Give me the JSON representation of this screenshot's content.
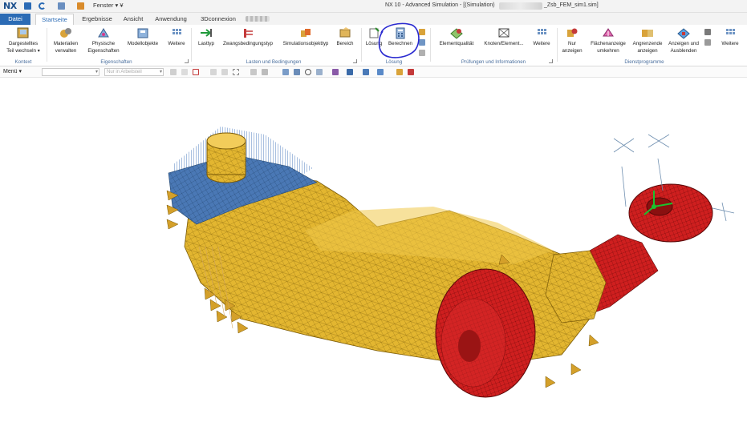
{
  "window": {
    "logo": "NX",
    "window_menu": "Fenster ▾ ¥",
    "title": "NX 10 - Advanced Simulation - [(Simulation)",
    "title_file": "_Zsb_FEM_sim1.sim]"
  },
  "tabs": [
    {
      "label": "Datei",
      "active": false
    },
    {
      "label": "Startseite",
      "active": true
    },
    {
      "label": "Ergebnisse",
      "active": false
    },
    {
      "label": "Ansicht",
      "active": false
    },
    {
      "label": "Anwendung",
      "active": false
    },
    {
      "label": "3Dconnexion",
      "active": false
    }
  ],
  "ribbon": {
    "kontext": {
      "group_label": "Kontext",
      "btn1_line1": "Dargestelltes",
      "btn1_line2": "Teil wechseln ▾"
    },
    "eigenschaften": {
      "group_label": "Eigenschaften",
      "materialien_line1": "Materialien",
      "materialien_line2": "verwalten",
      "physische_line1": "Physische",
      "physische_line2": "Eigenschaften",
      "modellobjekte": "Modellobjekte",
      "weitere": "Weitere"
    },
    "lasten": {
      "group_label": "Lasten und Bedingungen",
      "lasttyp": "Lasttyp",
      "zwangs": "Zwangsbedingungstyp",
      "simobj": "Simulationsobjekttyp",
      "bereich": "Bereich"
    },
    "loesung": {
      "group_label": "Lösung",
      "loesung": "Lösung",
      "berechnen": "Berechnen"
    },
    "pruefungen": {
      "group_label": "Prüfungen und Informationen",
      "elementqualitaet": "Elementqualität",
      "knoten": "Knoten/Element...",
      "weitere": "Weitere"
    },
    "dienst": {
      "group_label": "Dienstprogramme",
      "nur_line1": "Nur",
      "nur_line2": "anzeigen",
      "flaechen_line1": "Flächenanzeige",
      "flaechen_line2": "umkehren",
      "angrenz_line1": "Angrenzende",
      "angrenz_line2": "anzeigen",
      "anzeigen_line1": "Anzeigen und",
      "anzeigen_line2": "Ausblenden",
      "weitere": "Weitere"
    }
  },
  "command_bar": {
    "menu_label": "Menü ▾",
    "filter_placeholder": "Nur in Arbeitsteil"
  },
  "colors": {
    "accent": "#2b6bb5",
    "mesh_yellow": "#e0b52c",
    "mesh_red": "#cc1f1f",
    "mesh_blue": "#4a78b5",
    "annotation": "#2a2ad0"
  }
}
